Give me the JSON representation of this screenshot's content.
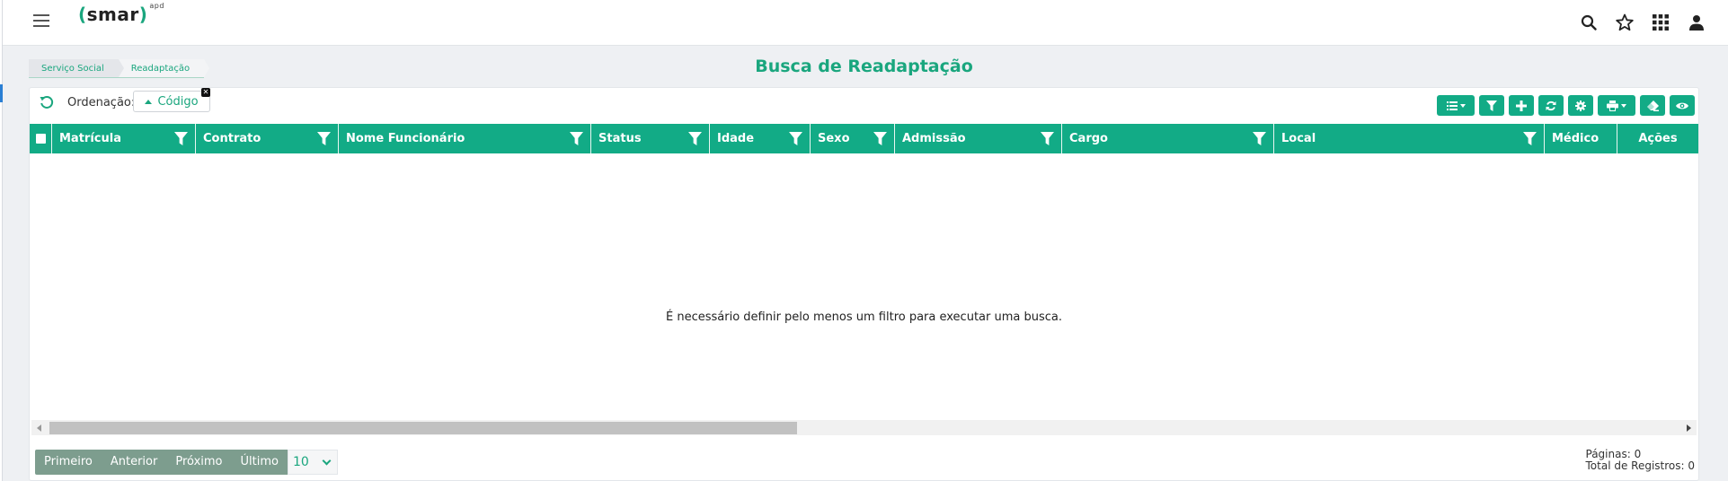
{
  "app": {
    "logo_text": "smar",
    "logo_open": "(",
    "logo_close": ")",
    "logo_super": "apd"
  },
  "breadcrumb": [
    {
      "label": "Serviço Social"
    },
    {
      "label": "Readaptação"
    }
  ],
  "page": {
    "title": "Busca de Readaptação"
  },
  "ordering": {
    "label": "Ordenação:",
    "chip_label": "Código"
  },
  "icons": {
    "topbar": [
      "search-icon",
      "star-icon",
      "apps-grid-icon",
      "user-icon"
    ],
    "toolbar": [
      "list-options-icon",
      "filter-icon",
      "plus-icon",
      "refresh-icon",
      "gear-icon",
      "print-icon",
      "eraser-icon",
      "eye-icon"
    ]
  },
  "grid": {
    "columns": [
      {
        "label": "Matrícula",
        "filter": true
      },
      {
        "label": "Contrato",
        "filter": true
      },
      {
        "label": "Nome Funcionário",
        "filter": true
      },
      {
        "label": "Status",
        "filter": true
      },
      {
        "label": "Idade",
        "filter": true
      },
      {
        "label": "Sexo",
        "filter": true
      },
      {
        "label": "Admissão",
        "filter": true
      },
      {
        "label": "Cargo",
        "filter": true
      },
      {
        "label": "Local",
        "filter": true
      },
      {
        "label": "Médico",
        "filter": false
      },
      {
        "label": "Ações",
        "filter": false
      }
    ],
    "empty_message": "É necessário definir pelo menos um filtro para executar uma busca."
  },
  "pager": {
    "first": "Primeiro",
    "previous": "Anterior",
    "next": "Próximo",
    "last": "Último",
    "page_size": "10"
  },
  "stats": {
    "pages": "Páginas: 0",
    "total": "Total de Registros: 0"
  },
  "colors": {
    "accent": "#12ab86",
    "brand_text": "#1aa67e",
    "pager": "#7d9d8e"
  }
}
